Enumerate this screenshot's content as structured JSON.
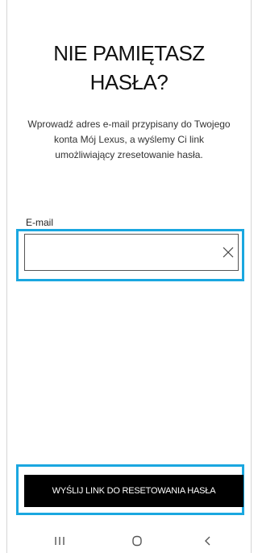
{
  "page": {
    "title_line1": "NIE PAMIĘTASZ",
    "title_line2": "HASŁA?",
    "subtitle": "Wprowadź adres e-mail przypisany do Twojego konta Mój Lexus, a wyślemy Ci link umożliwiający zresetowanie hasła."
  },
  "email": {
    "label": "E-mail",
    "value": "",
    "placeholder": ""
  },
  "submit_button": {
    "label": "WYŚLIJ LINK DO RESETOWANIA HASŁA"
  },
  "colors": {
    "highlight": "#1aa7e0",
    "button_bg": "#000000",
    "button_text": "#ffffff"
  },
  "icons": {
    "clear": "close-icon",
    "recents": "recents-icon",
    "home": "home-icon",
    "back": "back-icon"
  }
}
